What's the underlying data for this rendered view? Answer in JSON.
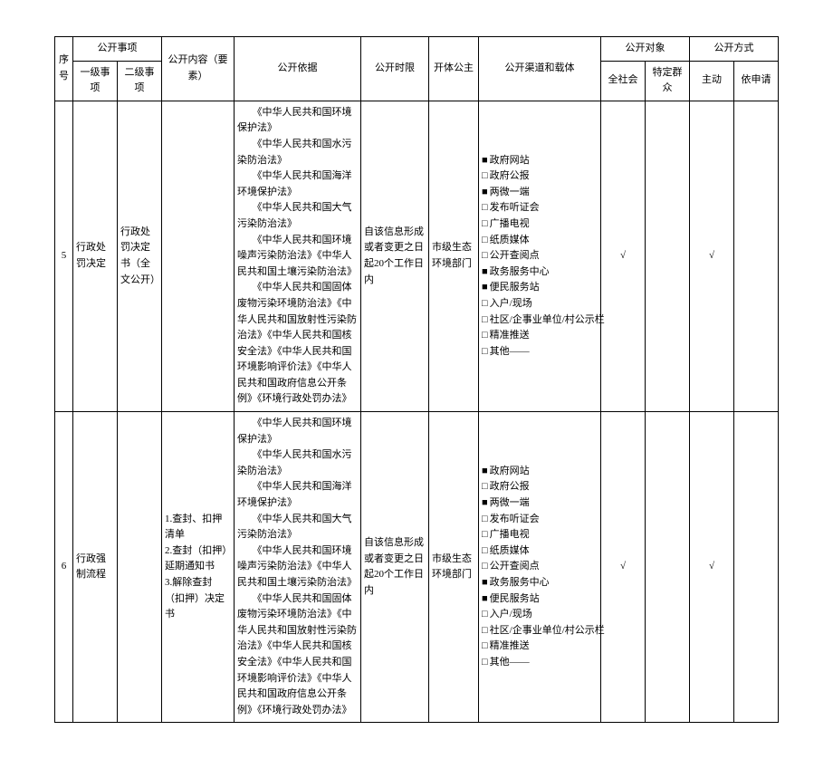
{
  "header": {
    "seq": "序号",
    "matter": "公开事项",
    "level1": "一级事项",
    "level2": "二级事项",
    "content": "公开内容（要素）",
    "basis": "公开依据",
    "time": "公开时限",
    "subject": "开体公主",
    "channel": "公开渠道和载体",
    "target": "公开对象",
    "target_all": "全社会",
    "target_spec": "特定群众",
    "way": "公开方式",
    "way_active": "主动",
    "way_apply": "依申请"
  },
  "channels": [
    "政府网站",
    "政府公报",
    "两微一端",
    "发布听证会",
    "广播电视",
    "纸质媒体",
    "公开查阅点",
    "政务服务中心",
    "便民服务站",
    "入户/现场",
    "社区/企事业单位/村公示栏",
    "精准推送",
    "其他——"
  ],
  "rows": [
    {
      "seq": "5",
      "level1": "行政处罚决定",
      "level2": "行政处罚决定书（全文公开）",
      "content_lines": [],
      "basis_lines": [
        "《中华人民共和国环境保护法》",
        "《中华人民共和国水污染防治法》",
        "《中华人民共和国海洋环境保护法》",
        "《中华人民共和国大气污染防治法》",
        "《中华人民共和国环境噪声污染防治法》《中华人民共和国土壤污染防治法》",
        "《中华人民共和国固体废物污染环境防治法》《中华人民共和国放射性污染防治法》《中华人民共和国核安全法》《中华人民共和国环境影响评价法》《中华人民共和国政府信息公开条例》《环境行政处罚办法》"
      ],
      "time": "自该信息形成或者变更之日起20个工作日内",
      "subject": "市级生态环境部门",
      "channel_checked": [
        0,
        2,
        7,
        8
      ],
      "tgt_all": "√",
      "tgt_spec": "",
      "way_active": "√",
      "way_apply": ""
    },
    {
      "seq": "6",
      "level1": "行政强制流程",
      "level2": "",
      "content_lines": [
        "1.查封、扣押清单",
        "2.查封（扣押）延期通知书",
        "3.解除查封（扣押）决定书"
      ],
      "basis_lines": [
        "《中华人民共和国环境保护法》",
        "《中华人民共和国水污染防治法》",
        "《中华人民共和国海洋环境保护法》",
        "《中华人民共和国大气污染防治法》",
        "《中华人民共和国环境噪声污染防治法》《中华人民共和国土壤污染防治法》",
        "《中华人民共和国固体废物污染环境防治法》《中华人民共和国放射性污染防治法》《中华人民共和国核安全法》《中华人民共和国环境影响评价法》《中华人民共和国政府信息公开条例》《环境行政处罚办法》"
      ],
      "time": "自该信息形成或者变更之日起20个工作日内",
      "subject": "市级生态环境部门",
      "channel_checked": [
        0,
        2,
        7,
        8
      ],
      "tgt_all": "√",
      "tgt_spec": "",
      "way_active": "√",
      "way_apply": ""
    }
  ],
  "marks": {
    "checked": "■",
    "unchecked": "□"
  }
}
